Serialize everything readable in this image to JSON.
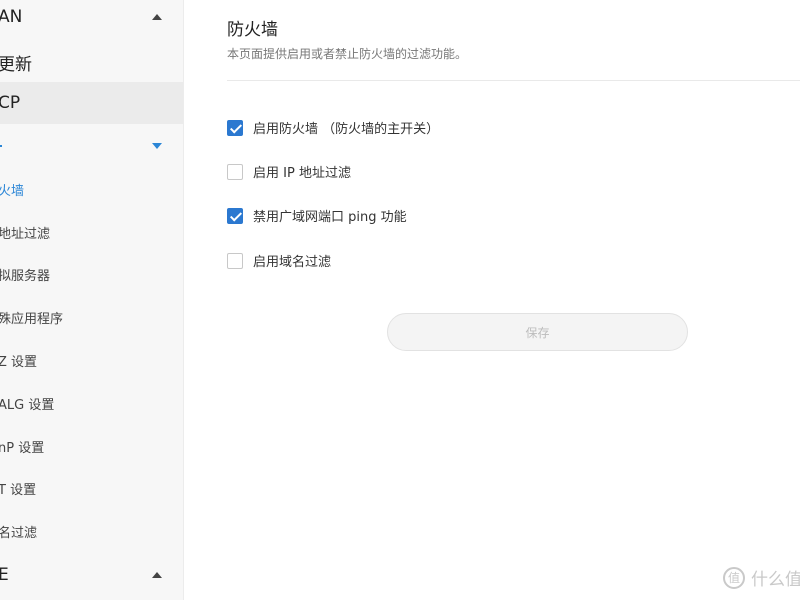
{
  "sidebar": {
    "items": [
      {
        "label": "AN",
        "kind": "group"
      },
      {
        "label": "更新",
        "kind": "group"
      },
      {
        "label": "CP",
        "kind": "group"
      },
      {
        "label": "",
        "kind": "group"
      },
      {
        "label": "火墙",
        "kind": "sub"
      },
      {
        "label": "地址过滤",
        "kind": "sub"
      },
      {
        "label": "拟服务器",
        "kind": "sub"
      },
      {
        "label": "殊应用程序",
        "kind": "sub"
      },
      {
        "label": "Z 设置",
        "kind": "sub"
      },
      {
        "label": "ALG 设置",
        "kind": "sub"
      },
      {
        "label": "nP 设置",
        "kind": "sub"
      },
      {
        "label": "T 设置",
        "kind": "sub"
      },
      {
        "label": "名过滤",
        "kind": "sub"
      },
      {
        "label": "E",
        "kind": "group"
      }
    ]
  },
  "main": {
    "title": "防火墙",
    "description": "本页面提供启用或者禁止防火墙的过滤功能。",
    "options": [
      {
        "label": "启用防火墙 （防火墙的主开关）",
        "checked": true
      },
      {
        "label": "启用 IP 地址过滤",
        "checked": false
      },
      {
        "label": "禁用广域网端口 ping 功能",
        "checked": true
      },
      {
        "label": "启用域名过滤",
        "checked": false
      }
    ],
    "save_label": "保存"
  },
  "watermark": {
    "icon_char": "值",
    "text": "什么值"
  },
  "colors": {
    "accent": "#2b78d0",
    "active_text": "#2b86d6",
    "sidebar_bg": "#f7f7f7"
  }
}
